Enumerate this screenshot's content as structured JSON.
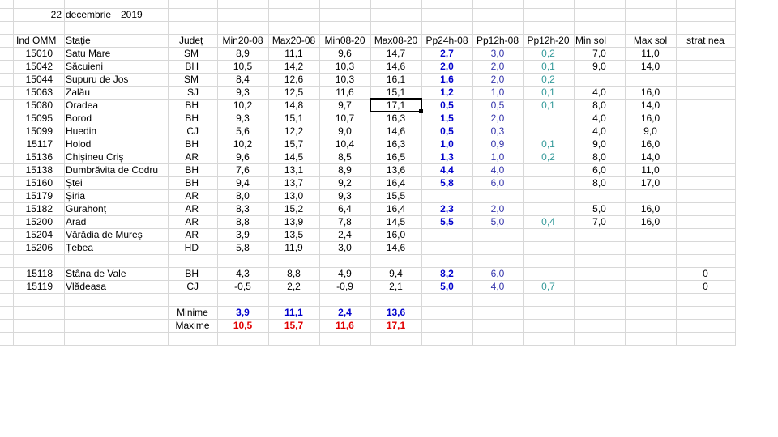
{
  "colors": {
    "precip_24h": "#0000cc",
    "precip_12h_08": "#3333aa",
    "precip_12h_20": "#339999",
    "min_red": "#0000cc",
    "max_red": "#e00000"
  },
  "header": {
    "day": "22",
    "month": "decembrie",
    "year": "2019"
  },
  "columns": [
    "Ind OMM",
    "Stație",
    "Județ",
    "Min20-08",
    "Max20-08",
    "Min08-20",
    "Max08-20",
    "Pp24h-08",
    "Pp12h-08",
    "Pp12h-20",
    "Min sol",
    "Max sol",
    "strat nea"
  ],
  "rows": [
    {
      "ind": "15010",
      "station": "Satu Mare",
      "judet": "SM",
      "min2008": "8,9",
      "max2008": "11,1",
      "min0820": "9,6",
      "max0820": "14,7",
      "pp24": "2,7",
      "pp1208": "3,0",
      "pp1220": "0,2",
      "minsol": "7,0",
      "maxsol": "11,0",
      "nea": ""
    },
    {
      "ind": "15042",
      "station": "Săcuieni",
      "judet": "BH",
      "min2008": "10,5",
      "max2008": "14,2",
      "min0820": "10,3",
      "max0820": "14,6",
      "pp24": "2,0",
      "pp1208": "2,0",
      "pp1220": "0,1",
      "minsol": "9,0",
      "maxsol": "14,0",
      "nea": ""
    },
    {
      "ind": "15044",
      "station": "Supuru de Jos",
      "judet": "SM",
      "min2008": "8,4",
      "max2008": "12,6",
      "min0820": "10,3",
      "max0820": "16,1",
      "pp24": "1,6",
      "pp1208": "2,0",
      "pp1220": "0,2",
      "minsol": "",
      "maxsol": "",
      "nea": ""
    },
    {
      "ind": "15063",
      "station": "Zalău",
      "judet": "SJ",
      "min2008": "9,3",
      "max2008": "12,5",
      "min0820": "11,6",
      "max0820": "15,1",
      "pp24": "1,2",
      "pp1208": "1,0",
      "pp1220": "0,1",
      "minsol": "4,0",
      "maxsol": "16,0",
      "nea": ""
    },
    {
      "ind": "15080",
      "station": "Oradea",
      "judet": "BH",
      "min2008": "10,2",
      "max2008": "14,8",
      "min0820": "9,7",
      "max0820": "17,1",
      "pp24": "0,5",
      "pp1208": "0,5",
      "pp1220": "0,1",
      "minsol": "8,0",
      "maxsol": "14,0",
      "nea": ""
    },
    {
      "ind": "15095",
      "station": "Borod",
      "judet": "BH",
      "min2008": "9,3",
      "max2008": "15,1",
      "min0820": "10,7",
      "max0820": "16,3",
      "pp24": "1,5",
      "pp1208": "2,0",
      "pp1220": "",
      "minsol": "4,0",
      "maxsol": "16,0",
      "nea": ""
    },
    {
      "ind": "15099",
      "station": "Huedin",
      "judet": "CJ",
      "min2008": "5,6",
      "max2008": "12,2",
      "min0820": "9,0",
      "max0820": "14,6",
      "pp24": "0,5",
      "pp1208": "0,3",
      "pp1220": "",
      "minsol": "4,0",
      "maxsol": "9,0",
      "nea": ""
    },
    {
      "ind": "15117",
      "station": "Holod",
      "judet": "BH",
      "min2008": "10,2",
      "max2008": "15,7",
      "min0820": "10,4",
      "max0820": "16,3",
      "pp24": "1,0",
      "pp1208": "0,9",
      "pp1220": "0,1",
      "minsol": "9,0",
      "maxsol": "16,0",
      "nea": ""
    },
    {
      "ind": "15136",
      "station": "Chișineu    Criș",
      "judet": "AR",
      "min2008": "9,6",
      "max2008": "14,5",
      "min0820": "8,5",
      "max0820": "16,5",
      "pp24": "1,3",
      "pp1208": "1,0",
      "pp1220": "0,2",
      "minsol": "8,0",
      "maxsol": "14,0",
      "nea": ""
    },
    {
      "ind": "15138",
      "station": "Dumbrăvița de Codru",
      "judet": "BH",
      "min2008": "7,6",
      "max2008": "13,1",
      "min0820": "8,9",
      "max0820": "13,6",
      "pp24": "4,4",
      "pp1208": "4,0",
      "pp1220": "",
      "minsol": "6,0",
      "maxsol": "11,0",
      "nea": ""
    },
    {
      "ind": "15160",
      "station": "Ștei",
      "judet": "BH",
      "min2008": "9,4",
      "max2008": "13,7",
      "min0820": "9,2",
      "max0820": "16,4",
      "pp24": "5,8",
      "pp1208": "6,0",
      "pp1220": "",
      "minsol": "8,0",
      "maxsol": "17,0",
      "nea": ""
    },
    {
      "ind": "15179",
      "station": "Șiria",
      "judet": "AR",
      "min2008": "8,0",
      "max2008": "13,0",
      "min0820": "9,3",
      "max0820": "15,5",
      "pp24": "",
      "pp1208": "",
      "pp1220": "",
      "minsol": "",
      "maxsol": "",
      "nea": ""
    },
    {
      "ind": "15182",
      "station": "Gurahonț",
      "judet": "AR",
      "min2008": "8,3",
      "max2008": "15,2",
      "min0820": "6,4",
      "max0820": "16,4",
      "pp24": "2,3",
      "pp1208": "2,0",
      "pp1220": "",
      "minsol": "5,0",
      "maxsol": "16,0",
      "nea": ""
    },
    {
      "ind": "15200",
      "station": "Arad",
      "judet": "AR",
      "min2008": "8,8",
      "max2008": "13,9",
      "min0820": "7,8",
      "max0820": "14,5",
      "pp24": "5,5",
      "pp1208": "5,0",
      "pp1220": "0,4",
      "minsol": "7,0",
      "maxsol": "16,0",
      "nea": ""
    },
    {
      "ind": "15204",
      "station": "Vărădia de Mureș",
      "judet": "AR",
      "min2008": "3,9",
      "max2008": "13,5",
      "min0820": "2,4",
      "max0820": "16,0",
      "pp24": "",
      "pp1208": "",
      "pp1220": "",
      "minsol": "",
      "maxsol": "",
      "nea": ""
    },
    {
      "ind": "15206",
      "station": "Țebea",
      "judet": "HD",
      "min2008": "5,8",
      "max2008": "11,9",
      "min0820": "3,0",
      "max0820": "14,6",
      "pp24": "",
      "pp1208": "",
      "pp1220": "",
      "minsol": "",
      "maxsol": "",
      "nea": ""
    }
  ],
  "mountain_rows": [
    {
      "ind": "15118",
      "station": "Stâna de Vale",
      "judet": "BH",
      "min2008": "4,3",
      "max2008": "8,8",
      "min0820": "4,9",
      "max0820": "9,4",
      "pp24": "8,2",
      "pp1208": "6,0",
      "pp1220": "",
      "minsol": "",
      "maxsol": "",
      "nea": "0"
    },
    {
      "ind": "15119",
      "station": "Vlădeasa",
      "judet": "CJ",
      "min2008": "-0,5",
      "max2008": "2,2",
      "min0820": "-0,9",
      "max0820": "2,1",
      "pp24": "5,0",
      "pp1208": "4,0",
      "pp1220": "0,7",
      "minsol": "",
      "maxsol": "",
      "nea": "0"
    }
  ],
  "summary": {
    "min_label": "Minime",
    "max_label": "Maxime",
    "min": [
      "3,9",
      "11,1",
      "2,4",
      "13,6"
    ],
    "max": [
      "10,5",
      "15,7",
      "11,6",
      "17,1"
    ]
  }
}
